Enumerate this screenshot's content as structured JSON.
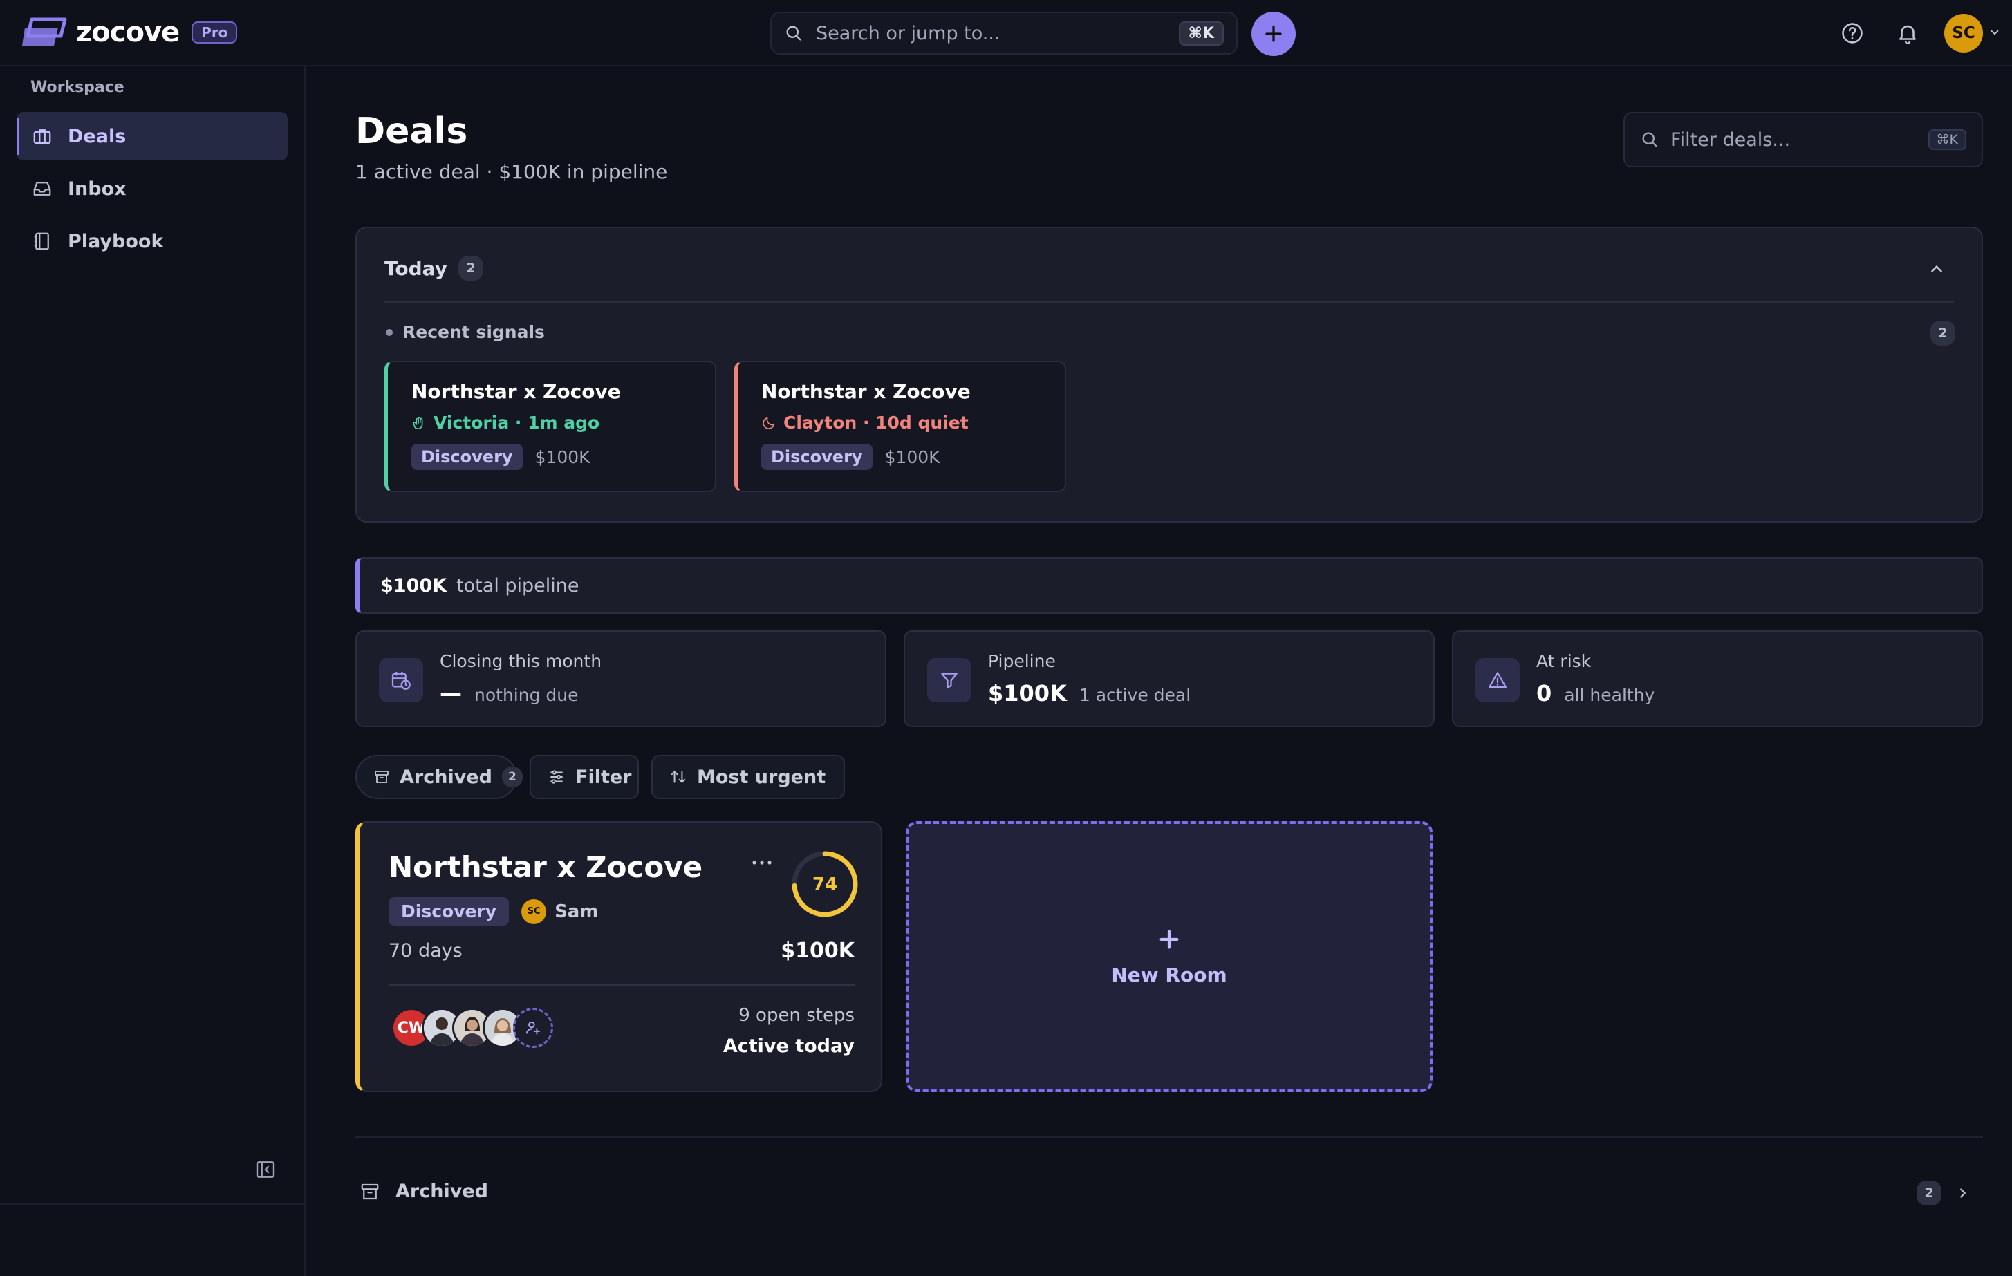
{
  "app": {
    "name": "zocove",
    "plan_badge": "Pro",
    "search_placeholder": "Search or jump to...",
    "search_shortcut": "⌘K",
    "user_initials": "SC"
  },
  "sidebar": {
    "section_label": "Workspace",
    "items": [
      {
        "label": "Deals",
        "icon": "briefcase-icon",
        "active": true
      },
      {
        "label": "Inbox",
        "icon": "inbox-icon",
        "active": false
      },
      {
        "label": "Playbook",
        "icon": "book-icon",
        "active": false
      }
    ]
  },
  "page": {
    "title": "Deals",
    "subtitle": "1 active deal · $100K in pipeline",
    "filter_placeholder": "Filter deals...",
    "filter_shortcut": "⌘K"
  },
  "today": {
    "title": "Today",
    "count": "2",
    "signals_label": "Recent signals",
    "signals_count": "2",
    "signals": [
      {
        "deal": "Northstar x Zocove",
        "activity": "Victoria · 1m ago",
        "stage": "Discovery",
        "amount": "$100K",
        "tone": "#4fd1a5"
      },
      {
        "deal": "Northstar x Zocove",
        "activity": "Clayton · 10d quiet",
        "stage": "Discovery",
        "amount": "$100K",
        "tone": "#f0837c"
      }
    ]
  },
  "pipeline": {
    "total_amount": "$100K",
    "total_label": "total pipeline"
  },
  "stats": [
    {
      "label": "Closing this month",
      "value": "—",
      "detail": "nothing due",
      "icon": "calendar-clock-icon"
    },
    {
      "label": "Pipeline",
      "value": "$100K",
      "detail": "1 active deal",
      "icon": "funnel-icon"
    },
    {
      "label": "At risk",
      "value": "0",
      "detail": "all healthy",
      "icon": "warning-icon"
    }
  ],
  "toolbar": {
    "archived_label": "Archived",
    "archived_count": "2",
    "filter_label": "Filter",
    "sort_label": "Most urgent"
  },
  "deal_card": {
    "name": "Northstar x Zocove",
    "stage": "Discovery",
    "owner_initials": "SC",
    "owner_name": "Sam",
    "age": "70 days",
    "amount": "$100K",
    "score": 74,
    "score_color": "#f2c53d",
    "first_participant_initials": "CW",
    "open_steps": "9 open steps",
    "activity": "Active today"
  },
  "new_room": {
    "label": "New Room"
  },
  "archived_section": {
    "label": "Archived",
    "count": "2"
  },
  "colors": {
    "accent": "#8c7ff0",
    "positive": "#4fd1a5",
    "negative": "#f0837c",
    "warning": "#f2c53d"
  }
}
